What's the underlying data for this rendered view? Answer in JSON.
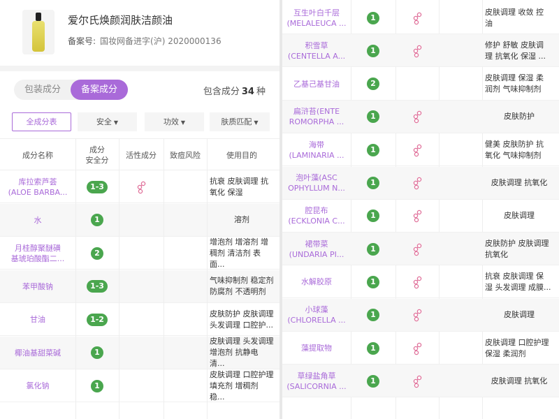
{
  "product": {
    "name": "爱尔氏焕颜润肤洁颜油",
    "reg_label": "备案号:",
    "reg_value": "国妆网备进字(沪) 2020000136"
  },
  "tabs": {
    "packaging": "包装成分",
    "registered": "备案成分"
  },
  "count": {
    "prefix": "包含成分",
    "num": "34",
    "suffix": "种"
  },
  "filters": [
    {
      "label": "全成分表",
      "dropdown": false
    },
    {
      "label": "安全",
      "dropdown": true
    },
    {
      "label": "功效",
      "dropdown": true
    },
    {
      "label": "肤质匹配",
      "dropdown": true
    }
  ],
  "columns": {
    "name": "成分名称",
    "score": "成分\n安全分",
    "active": "活性成分",
    "acne": "致痘风险",
    "use": "使用目的"
  },
  "left_rows": [
    {
      "name": "库拉索芦荟\n(ALOE BARBA...",
      "score": "1-3",
      "active": true,
      "use": "抗衰 皮肤调理 抗\n氧化 保湿"
    },
    {
      "name": "水",
      "score": "1",
      "active": false,
      "use": "溶剂"
    },
    {
      "name": "月桂醇聚醚磺\n基琥珀酸酯二...",
      "score": "2",
      "active": false,
      "use": "增泡剂 增溶剂 增\n稠剂 清洁剂 表面..."
    },
    {
      "name": "苯甲酸钠",
      "score": "1-3",
      "active": false,
      "use": "气味抑制剂 稳定剂\n防腐剂 不透明剂"
    },
    {
      "name": "甘油",
      "score": "1-2",
      "active": false,
      "use": "皮肤防护 皮肤调理\n头发调理 口腔护..."
    },
    {
      "name": "椰油基甜菜碱",
      "score": "1",
      "active": false,
      "use": "皮肤调理 头发调理\n增泡剂 抗静电 清..."
    },
    {
      "name": "氯化钠",
      "score": "1",
      "active": false,
      "use": "皮肤调理 口腔护理\n填充剂 增稠剂 稳..."
    }
  ],
  "right_rows": [
    {
      "name": "互生叶白千层\n(MELALEUCA ...",
      "score": "1",
      "active": true,
      "use": "皮肤调理 收敛 控\n油"
    },
    {
      "name": "积雪草\n(CENTELLA A...",
      "score": "1",
      "active": true,
      "use": "修护 舒敏 皮肤调\n理 抗氧化 保湿 ..."
    },
    {
      "name": "乙基己基甘油",
      "score": "2",
      "active": false,
      "use": "皮肤调理 保湿 柔\n润剂 气味抑制剂"
    },
    {
      "name": "扁浒苔(ENTE\nROMORPHA ...",
      "score": "1",
      "active": true,
      "use": "皮肤防护"
    },
    {
      "name": "海带\n(LAMINARIA ...",
      "score": "1",
      "active": true,
      "use": "健美 皮肤防护 抗\n氧化 气味抑制剂"
    },
    {
      "name": "泡叶藻(ASC\nOPHYLLUM N...",
      "score": "1",
      "active": true,
      "use": "皮肤调理 抗氧化"
    },
    {
      "name": "腔昆布\n(ECKLONIA C...",
      "score": "1",
      "active": true,
      "use": "皮肤调理"
    },
    {
      "name": "裙带菜\n(UNDARIA PI...",
      "score": "1",
      "active": true,
      "use": "皮肤防护 皮肤调理\n抗氧化"
    },
    {
      "name": "水解胶原",
      "score": "1",
      "active": true,
      "use": "抗衰 皮肤调理 保\n湿 头发调理 成膜..."
    },
    {
      "name": "小球藻\n(CHLORELLA ...",
      "score": "1",
      "active": true,
      "use": "皮肤调理"
    },
    {
      "name": "藻提取物",
      "score": "1",
      "active": true,
      "use": "皮肤调理 口腔护理\n保湿 柔润剂"
    },
    {
      "name": "草绿盐角草\n(SALICORNIA ...",
      "score": "1",
      "active": true,
      "use": "皮肤调理 抗氧化"
    }
  ],
  "colors": {
    "accent": "#a96ad9",
    "score_green": "#4aa64e",
    "active_icon": "#e0709a"
  },
  "icons": {
    "active": "molecule-icon",
    "caret": "caret-down-icon"
  }
}
